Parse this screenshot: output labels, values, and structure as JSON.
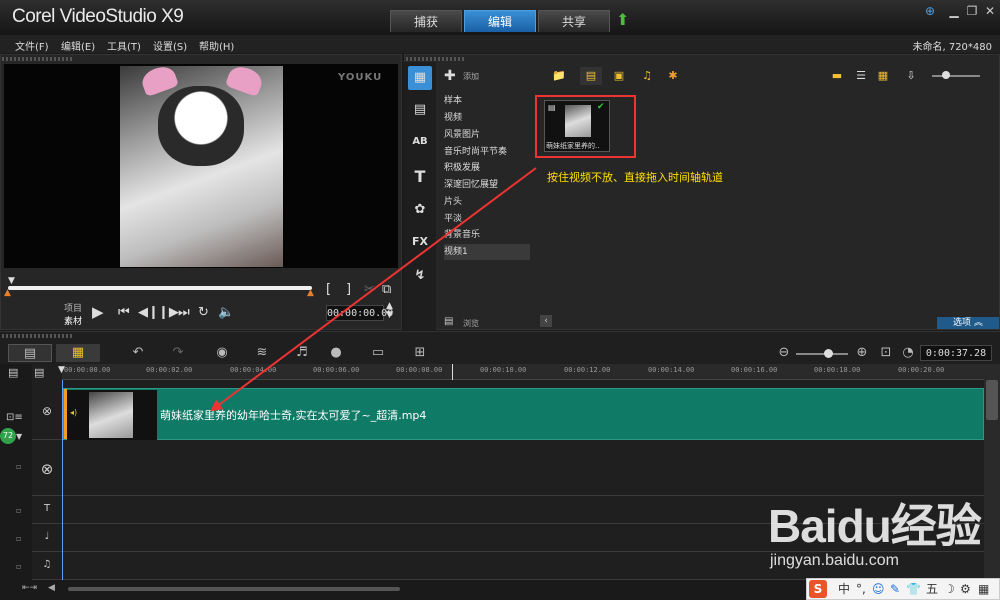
{
  "app": {
    "title": "Corel VideoStudio X9"
  },
  "mode_tabs": [
    {
      "label": "捕获"
    },
    {
      "label": "编辑"
    },
    {
      "label": "共享"
    }
  ],
  "active_tab": "编辑",
  "menu": [
    {
      "label": "文件(F)"
    },
    {
      "label": "编辑(E)"
    },
    {
      "label": "工具(T)"
    },
    {
      "label": "设置(S)"
    },
    {
      "label": "帮助(H)"
    }
  ],
  "project_info": "未命名, 720*480",
  "preview": {
    "watermark": "YOUKU",
    "mode_labels": [
      "项目",
      "素材"
    ],
    "timecode": "00:00:00.00",
    "controls": [
      "play",
      "prev",
      "step-back",
      "step-forward",
      "next",
      "repeat",
      "volume"
    ]
  },
  "library": {
    "add_label": "添加",
    "browse_label": "浏览",
    "folders": [
      "样本",
      "视频",
      "风景图片",
      "音乐时尚平节奏",
      "积极发展",
      "深邃回忆展望",
      "片头",
      "平淡",
      "背景音乐",
      "视频1"
    ],
    "selected_folder": "视频1",
    "sidebar_icons": [
      "media-icon",
      "instant-project-icon",
      "transition-icon",
      "title-icon",
      "graphic-icon",
      "filter-icon",
      "path-icon"
    ],
    "thumbnail_caption": "萌妹纸家里养的..",
    "option_label": "选项"
  },
  "annotation": "按住视频不放、直接拖入时间轴轨道",
  "timeline": {
    "timecode": "0:00:37.28",
    "ruler_ticks": [
      "00:00:00.00",
      "00:00:02.00",
      "00:00:04.00",
      "00:00:06.00",
      "00:00:08.00",
      "00:00:10.00",
      "00:00:12.00",
      "00:00:14.00",
      "00:00:16.00",
      "00:00:18.00",
      "00:00:20.00"
    ],
    "clip_label": "萌妹纸家里养的幼年哈士奇,实在太可爱了~_超清.mp4",
    "badge": "72"
  },
  "watermark": {
    "brand": "Baidu经验",
    "url": "jingyan.baidu.com"
  },
  "ime": {
    "items": [
      "中",
      "°,",
      "☺",
      "✎",
      "👕",
      "五",
      "☽",
      "⚙",
      "▦"
    ]
  }
}
